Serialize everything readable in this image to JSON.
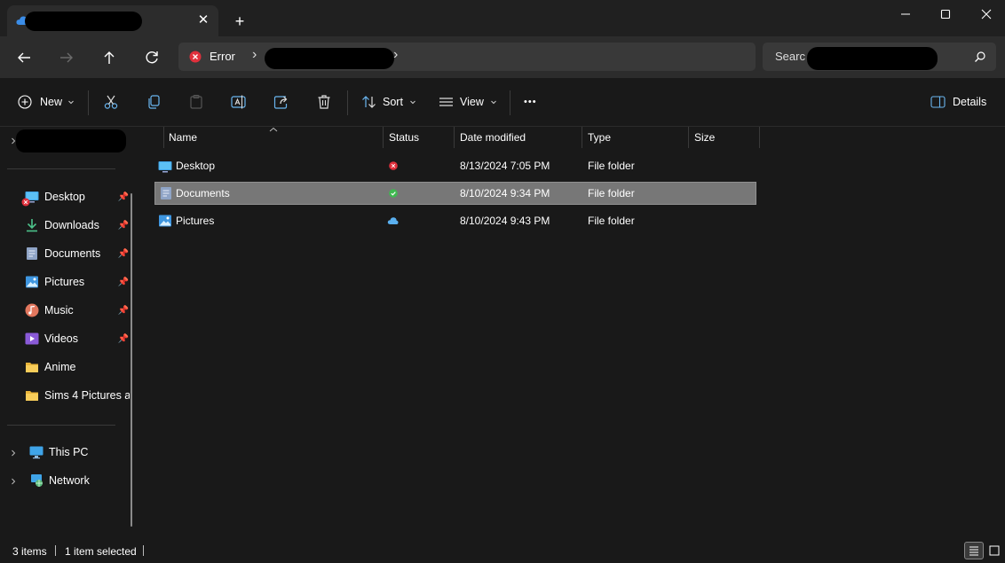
{
  "tab": {
    "close": "✕",
    "new_tab": "+"
  },
  "address": {
    "status_label": "Error",
    "chevron": "›"
  },
  "search": {
    "placeholder": "Searc"
  },
  "commands": {
    "new": "New",
    "sort": "Sort",
    "view": "View",
    "more": "•••",
    "details": "Details"
  },
  "sidebar": {
    "quick_access": [
      {
        "label": "Desktop",
        "icon": "desktop-icon",
        "pinned": true,
        "status": "error"
      },
      {
        "label": "Downloads",
        "icon": "downloads-icon",
        "pinned": true
      },
      {
        "label": "Documents",
        "icon": "documents-icon",
        "pinned": true
      },
      {
        "label": "Pictures",
        "icon": "pictures-icon",
        "pinned": true
      },
      {
        "label": "Music",
        "icon": "music-icon",
        "pinned": true
      },
      {
        "label": "Videos",
        "icon": "videos-icon",
        "pinned": true
      },
      {
        "label": "Anime",
        "icon": "folder-icon",
        "pinned": false
      },
      {
        "label": "Sims 4 Pictures a",
        "icon": "folder-icon",
        "pinned": false
      }
    ],
    "this_pc": "This PC",
    "network": "Network"
  },
  "columns": {
    "name": "Name",
    "status": "Status",
    "date": "Date modified",
    "type": "Type",
    "size": "Size"
  },
  "files": [
    {
      "name": "Desktop",
      "icon": "desktop-icon",
      "status": "error",
      "date": "8/13/2024 7:05 PM",
      "type": "File folder",
      "size": ""
    },
    {
      "name": "Documents",
      "icon": "documents-icon",
      "status": "synced",
      "date": "8/10/2024 9:34 PM",
      "type": "File folder",
      "size": "",
      "selected": true
    },
    {
      "name": "Pictures",
      "icon": "pictures-icon",
      "status": "cloud",
      "date": "8/10/2024 9:43 PM",
      "type": "File folder",
      "size": ""
    }
  ],
  "statusbar": {
    "item_count": "3 items",
    "selected": "1 item selected"
  },
  "colors": {
    "bg": "#191919",
    "selection": "#777777",
    "error": "#e0303c",
    "synced": "#3fb950",
    "cloud": "#5ab0f0",
    "folder": "#f5c242"
  }
}
